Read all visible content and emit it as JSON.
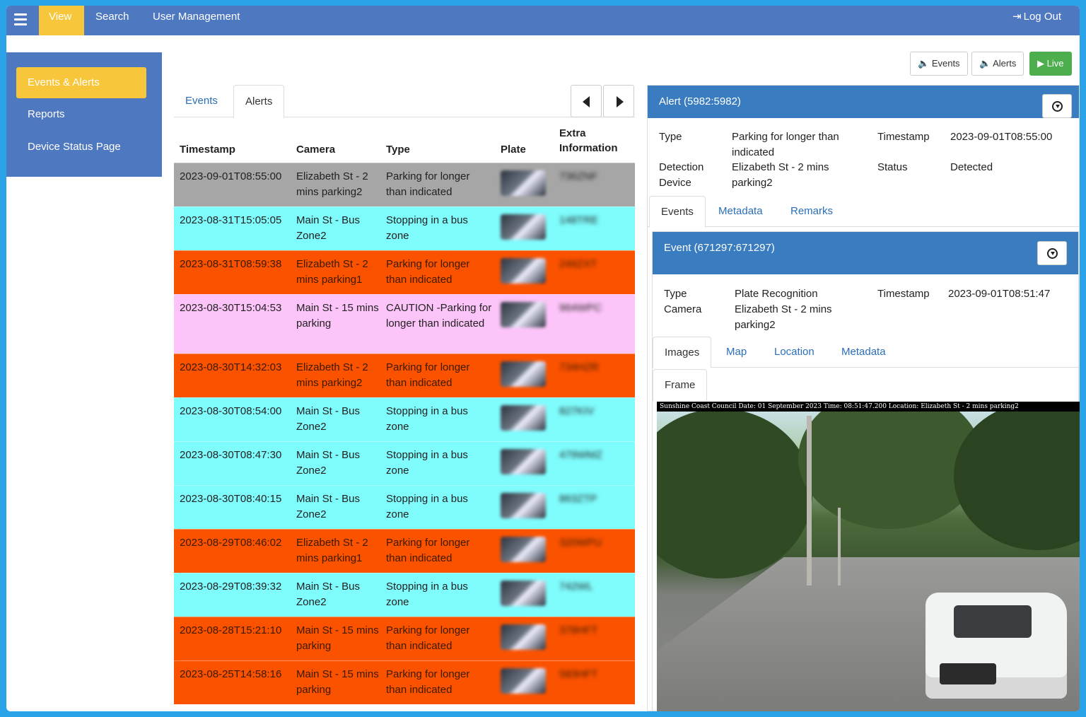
{
  "nav": {
    "items": [
      "View",
      "Search",
      "User Management"
    ],
    "active": "View",
    "logout": "Log Out"
  },
  "sidebar": {
    "items": [
      "Events & Alerts",
      "Reports",
      "Device Status Page"
    ],
    "active": "Events & Alerts"
  },
  "topbuttons": {
    "events": "Events",
    "alerts": "Alerts",
    "live": "Live"
  },
  "list": {
    "tabs": [
      "Events",
      "Alerts"
    ],
    "selected_tab": "Alerts",
    "columns": [
      "Timestamp",
      "Camera",
      "Type",
      "Plate",
      "Extra Information"
    ],
    "rows": [
      {
        "timestamp": "2023-09-01T08:55:00",
        "camera": "Elizabeth St - 2 mins parking2",
        "type": "Parking for longer than indicated",
        "extra": "736ZNF",
        "color": "#a6a6a6"
      },
      {
        "timestamp": "2023-08-31T15:05:05",
        "camera": "Main St - Bus Zone2",
        "type": "Stopping in a bus zone",
        "extra": "148TRE",
        "color": "#7ffcfc"
      },
      {
        "timestamp": "2023-08-31T08:59:38",
        "camera": "Elizabeth St - 2 mins parking1",
        "type": "Parking for longer than indicated",
        "extra": "249ZXT",
        "color": "#fb5200"
      },
      {
        "timestamp": "2023-08-30T15:04:53",
        "camera": "Main St - 15 mins parking",
        "type": "CAUTION -Parking for longer than indicated",
        "extra": "964WPC",
        "color": "#fcc4f8"
      },
      {
        "timestamp": "2023-08-30T14:32:03",
        "camera": "Elizabeth St - 2 mins parking2",
        "type": "Parking for longer than indicated",
        "extra": "734HZR",
        "color": "#fb5200"
      },
      {
        "timestamp": "2023-08-30T08:54:00",
        "camera": "Main St - Bus Zone2",
        "type": "Stopping in a bus zone",
        "extra": "827KIV",
        "color": "#7ffcfc"
      },
      {
        "timestamp": "2023-08-30T08:47:30",
        "camera": "Main St - Bus Zone2",
        "type": "Stopping in a bus zone",
        "extra": "479WMZ",
        "color": "#7ffcfc"
      },
      {
        "timestamp": "2023-08-30T08:40:15",
        "camera": "Main St - Bus Zone2",
        "type": "Stopping in a bus zone",
        "extra": "863ZTP",
        "color": "#7ffcfc"
      },
      {
        "timestamp": "2023-08-29T08:46:02",
        "camera": "Elizabeth St - 2 mins parking1",
        "type": "Parking for longer than indicated",
        "extra": "320WPU",
        "color": "#fb5200"
      },
      {
        "timestamp": "2023-08-29T08:39:32",
        "camera": "Main St - Bus Zone2",
        "type": "Stopping in a bus zone",
        "extra": "742WL",
        "color": "#7ffcfc"
      },
      {
        "timestamp": "2023-08-28T15:21:10",
        "camera": "Main St - 15 mins parking",
        "type": "Parking for longer than indicated",
        "extra": "378HFT",
        "color": "#fb5200"
      },
      {
        "timestamp": "2023-08-25T14:58:16",
        "camera": "Main St - 15 mins parking",
        "type": "Parking for longer than indicated",
        "extra": "583HFT",
        "color": "#fb5200"
      }
    ]
  },
  "alert": {
    "title": "Alert (5982:5982)",
    "type_label": "Type",
    "type_value": "Parking for longer than indicated",
    "timestamp_label": "Timestamp",
    "timestamp_value": "2023-09-01T08:55:00",
    "device_label": "Detection Device",
    "device_value": "Elizabeth St - 2 mins parking2",
    "status_label": "Status",
    "status_value": "Detected",
    "tabs": [
      "Events",
      "Metadata",
      "Remarks"
    ],
    "selected_tab": "Events"
  },
  "event": {
    "title": "Event (671297:671297)",
    "type_label": "Type",
    "type_value": "Plate Recognition",
    "camera_label": "Camera",
    "camera_value": "Elizabeth St - 2 mins parking2",
    "timestamp_label": "Timestamp",
    "timestamp_value": "2023-09-01T08:51:47",
    "tabs": [
      "Images",
      "Map",
      "Location",
      "Metadata"
    ],
    "selected_tab": "Images",
    "subtab": "Frame",
    "image_caption": "Sunshine Coast Council Date: 01 September 2023  Time: 08:51:47.200  Location: Elizabeth St - 2 mins parking2"
  }
}
